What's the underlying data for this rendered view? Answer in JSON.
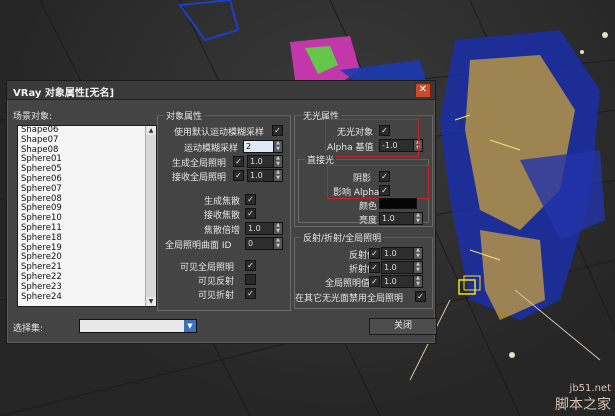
{
  "dialog": {
    "title": "VRay 对象属性[无名]",
    "scene_objects_label": "场景对象:",
    "objects": [
      "Shape06",
      "Shape07",
      "Shape08",
      "Sphere01",
      "Sphere05",
      "Sphere06",
      "Sphere07",
      "Sphere08",
      "Sphere09",
      "Sphere10",
      "Sphere11",
      "Sphere18",
      "Sphere19",
      "Sphere20",
      "Sphere21",
      "Sphere22",
      "Sphere23",
      "Sphere24"
    ],
    "selection_set_label": "选择集:",
    "selection_set_value": "",
    "close_button": "关闭"
  },
  "object_props": {
    "title": "对象属性",
    "use_default_motion_blur": "使用默认运动模糊采样",
    "motion_blur_samples_label": "运动模糊采样",
    "motion_blur_samples": "2",
    "generate_gi_label": "生成全局照明",
    "generate_gi_value": "1.0",
    "receive_gi_label": "接收全局照明",
    "receive_gi_value": "1.0",
    "generate_caustics": "生成焦散",
    "receive_caustics": "接收焦散",
    "caustics_mult_label": "焦散倍增",
    "caustics_mult": "1.0",
    "gi_surface_id_label": "全局照明曲面 ID",
    "gi_surface_id": "0",
    "visible_to_gi": "可见全局照明",
    "visible_in_reflections": "可见反射",
    "visible_in_refractions": "可见折射"
  },
  "matte_props": {
    "title": "无光属性",
    "matte_object": "无光对象",
    "alpha_contribution_label": "Alpha 基值",
    "alpha_contribution": "-1.0",
    "direct_light_title": "直接光",
    "shadows": "阴影",
    "affect_alpha": "影响 Alpha",
    "color_label": "颜色",
    "brightness_label": "亮度",
    "brightness": "1.0",
    "color_hex": "#050505"
  },
  "refl_props": {
    "title": "反射/折射/全局照明",
    "reflection_amount_label": "反射值",
    "reflection_amount": "1.0",
    "refraction_amount_label": "折射值",
    "refraction_amount": "1.0",
    "gi_amount_label": "全局照明值",
    "gi_amount": "1.0",
    "no_gi_on_other_mattes": "在其它无光面禁用全局照明"
  },
  "watermark": {
    "line1": "jb51.net",
    "line2": "脚本之家"
  },
  "colors": {
    "accent_red": "#c0232b",
    "close_red": "#c84b2c",
    "dialog_bg": "#444444"
  }
}
